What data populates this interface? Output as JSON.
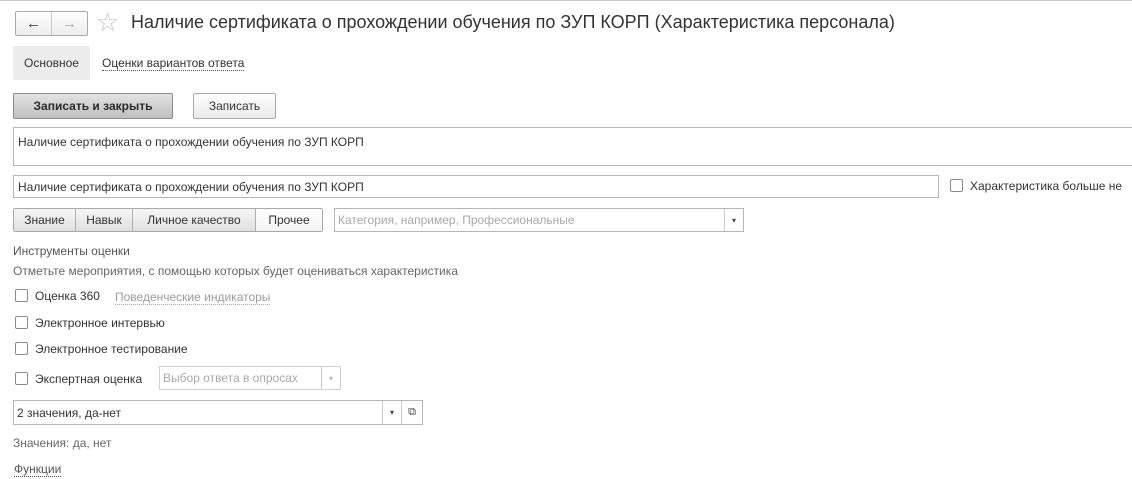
{
  "header": {
    "back_icon": "←",
    "forward_icon": "→",
    "star_icon": "☆",
    "title": "Наличие сертификата о прохождении обучения по ЗУП КОРП (Характеристика персонала)"
  },
  "tabs": {
    "main": "Основное",
    "answers": "Оценки вариантов ответа"
  },
  "toolbar": {
    "save_close_label": "Записать и закрыть",
    "save_label": "Записать"
  },
  "form": {
    "full_name": "Наличие сертификата о прохождении обучения по ЗУП КОРП",
    "name": "Наличие сертификата о прохождении обучения по ЗУП КОРП",
    "obsolete_label": "Характеристика больше не",
    "kinds": [
      "Знание",
      "Навык",
      "Личное качество",
      "Прочее"
    ],
    "category_placeholder": "Категория, например, Профессиональные",
    "dropdown_icon": "▾",
    "open_icon": "⧉"
  },
  "assessment": {
    "title": "Инструменты оценки",
    "hint": "Отметьте мероприятия, с помощью которых будет оцениваться характеристика",
    "eval360_label": "Оценка 360",
    "behavior_link": "Поведенческие индикаторы",
    "interview_label": "Электронное интервью",
    "testing_label": "Электронное тестирование",
    "expert_label": "Экспертная оценка",
    "expert_select_placeholder": "Выбор ответа в опросах"
  },
  "answers": {
    "type_value": "2 значения, да-нет",
    "values_text": "Значения: да, нет",
    "functions_link": "Функции"
  },
  "colors": {
    "text": "#333333",
    "border": "#b5b5b5",
    "tab_active_bg": "#ececec"
  }
}
